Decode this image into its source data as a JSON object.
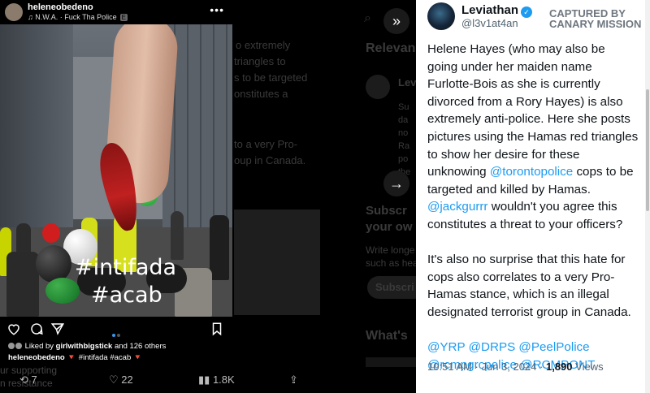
{
  "background_text": {
    "left_col_lines": [
      "o extremely",
      "triangles to",
      "s to be targeted",
      "onstitutes a",
      "",
      "",
      "to a very Pro-",
      "oup in Canada."
    ],
    "right_col_title": "Relevan",
    "right_col_user": "Levi",
    "right_col_lines": [
      "Su",
      "da",
      "no",
      "Ra",
      "po",
      "the"
    ],
    "subscribe_heading_lines": [
      "Subscr",
      "your ow"
    ],
    "subscribe_body_lines": [
      "Write longe",
      "such as hea"
    ],
    "subscribe_button": "Subscri",
    "whats_heading": "What's",
    "bottom_text_lines": [
      "ur  supporting",
      "n resistance"
    ]
  },
  "instagram": {
    "username": "heleneobedeno",
    "song": "N.W.A. · Fuck Tha Police",
    "song_badge": "E",
    "hashtag_overlay_1": "#intifada",
    "hashtag_overlay_2": "#acab",
    "liked_by_prefix": "Liked by ",
    "liked_by_user": "girlwithbigstick",
    "liked_by_suffix": " and 126 others",
    "caption_user": "heleneobedeno",
    "caption_text": " 🔻 #intifada #acab 🔻"
  },
  "bottom_bar": {
    "retweets": "7",
    "likes": "22",
    "views": "1.8K"
  },
  "tweet": {
    "name": "Leviathan",
    "handle": "@l3v1at4an",
    "stamp_line1": "CAPTURED BY",
    "stamp_line2": "CANARY MISSION",
    "p1_a": "Helene Hayes (who may also be going under her maiden name Furlotte-Bois as she is currently divorced from a Rory Hayes) is also extremely anti-police. Here she posts pictures using the Hamas red triangles to show her desire for these unknowing ",
    "p1_m1": "@torontopolice",
    "p1_b": " cops to be targeted and killed by Hamas. ",
    "p1_m2": "@jackgurrr",
    "p1_c": " wouldn't you agree this constitutes a threat to your officers?",
    "p2": "It's also no surprise that this hate for cops also correlates to a very Pro-Hamas stance, which is an illegal designated terrorist group in Canada.",
    "mentions_line1": "@YRP @DRPS @PeelPolice",
    "mentions_line2": "@rcmpgrcpolice @RCMPONT",
    "time": "10:51 AM · Jun 3, 2024 · ",
    "views_count": "1,890",
    "views_label": " Views"
  },
  "colors": {
    "link": "#1d9bf0",
    "tweet_bg": "#ffffff",
    "instagram_bg": "#000000"
  }
}
